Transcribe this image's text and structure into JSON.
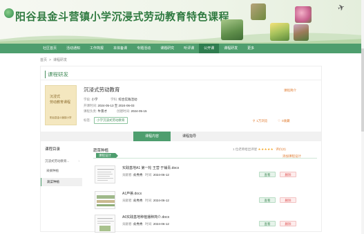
{
  "banner": {
    "title": "阳谷县金斗营镇小学沉浸式劳动教育特色课程"
  },
  "nav": {
    "items": [
      "社区首页",
      "活动通知",
      "工作简报",
      "本体备课",
      "专题活动",
      "课题研究",
      "听评课",
      "公开课",
      "课程研发",
      "更多"
    ],
    "active_index": 7
  },
  "breadcrumb": [
    "首页",
    "课程研发"
  ],
  "section": {
    "title": "课程研发"
  },
  "course": {
    "cover_lines": [
      "沉浸式",
      "劳动教育课程",
      "阳谷县金斗营镇小学"
    ],
    "title": "沉浸式劳动教育",
    "stage_label": "学段:",
    "stage": "小学",
    "subject_label": "学科:",
    "subject": "综合实践活动",
    "open_time_label": "开课时间:",
    "open_time": "2024-05-13 至 2024-06-03",
    "creator_label": "课程负责:",
    "creator": "牛景才",
    "created_label": "创建时间:",
    "created": "2024-05-15",
    "tag_label": "标签:",
    "tag": "小学沉浸式劳动教育",
    "link": "课程简介",
    "stats": [
      {
        "icon": "search-icon",
        "text": "1万浏览"
      },
      {
        "icon": "heart-icon",
        "text": "0收藏"
      }
    ]
  },
  "tabs": {
    "items": [
      "课程内容",
      "课程指导"
    ],
    "active_index": 0
  },
  "sidebar": {
    "title": "课程目录",
    "items": [
      "沉浸式劳动教育...",
      "采摘种植",
      "蔬菜种植"
    ],
    "active_index": 2
  },
  "content": {
    "title": "蔬菜种植",
    "rating_text": "1 位老师给出评星",
    "stars": "★★★★★",
    "rating_value": "评价(0)",
    "design_tag": "课程设计",
    "add_design": "添加课程设计",
    "docs": [
      {
        "name": "实践基地A1 第一轮 王营 于铺青.docx",
        "uploader_label": "贡献者:",
        "uploader": "俞秀秀",
        "time_label": "时间:",
        "time": "2024-06-12",
        "view": "查看",
        "delete": "删除"
      },
      {
        "name": "A1芦荟.docx",
        "uploader_label": "贡献者:",
        "uploader": "俞秀秀",
        "time_label": "时间:",
        "time": "2024-06-12",
        "view": "查看",
        "delete": "删除"
      },
      {
        "name": "A6实践基地种植播种简介.docx",
        "uploader_label": "贡献者:",
        "uploader": "俞秀秀",
        "time_label": "时间:",
        "time": "2024-06-12",
        "view": "查看",
        "delete": "删除"
      }
    ]
  },
  "colors": {
    "primary": "#4e9e6e",
    "nav_active": "#2f7d4f",
    "accent": "#e07a2e",
    "title": "#2f7a40"
  }
}
